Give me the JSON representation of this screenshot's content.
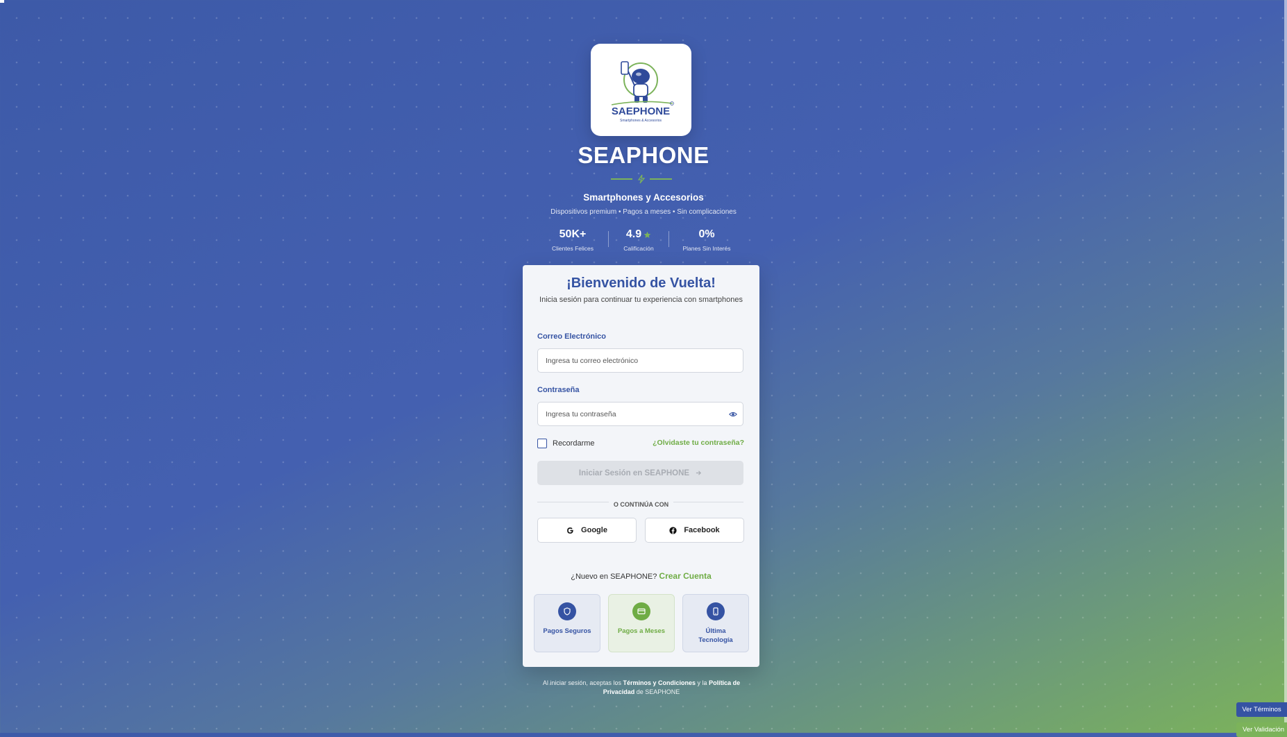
{
  "brand": {
    "logo_text": "SAEPHONE",
    "logo_subtext": "Smartphones & Accesorios",
    "name": "SEAPHONE",
    "tagline": "Smartphones y Accesorios",
    "subtagline": "Dispositivos premium • Pagos a meses • Sin complicaciones"
  },
  "stats": [
    {
      "value": "50K+",
      "label": "Clientes Felices"
    },
    {
      "value": "4.9",
      "label": "Calificación",
      "icon": "star-icon"
    },
    {
      "value": "0%",
      "label": "Planes Sin Interés"
    }
  ],
  "login": {
    "title": "¡Bienvenido de Vuelta!",
    "subtitle": "Inicia sesión para continuar tu experiencia con smartphones",
    "email_label": "Correo Electrónico",
    "email_placeholder": "Ingresa tu correo electrónico",
    "email_value": "",
    "password_label": "Contraseña",
    "password_placeholder": "Ingresa tu contraseña",
    "password_value": "",
    "remember_label": "Recordarme",
    "forgot_label": "¿Olvidaste tu contraseña?",
    "submit_label": "Iniciar Sesión en SEAPHONE",
    "or_label": "O CONTINÚA CON",
    "google_label": "Google",
    "facebook_label": "Facebook",
    "signup_prompt": "¿Nuevo en SEAPHONE?",
    "signup_link": "Crear Cuenta"
  },
  "features": [
    {
      "label": "Pagos Seguros",
      "icon": "shield-icon"
    },
    {
      "label": "Pagos a Meses",
      "icon": "credit-card-icon"
    },
    {
      "label": "Última Tecnología",
      "icon": "smartphone-icon"
    }
  ],
  "legal": {
    "prefix": "Al iniciar sesión, aceptas los",
    "terms": "Términos y Condiciones",
    "middle": "y la",
    "privacy": "Política de Privacidad",
    "suffix": "de SEAPHONE"
  },
  "floating": {
    "terms_button": "Ver Términos",
    "validation_button": "Ver Validación"
  },
  "colors": {
    "primary": "#3553a3",
    "accent": "#6fac45",
    "card_bg": "#f3f5f9"
  }
}
